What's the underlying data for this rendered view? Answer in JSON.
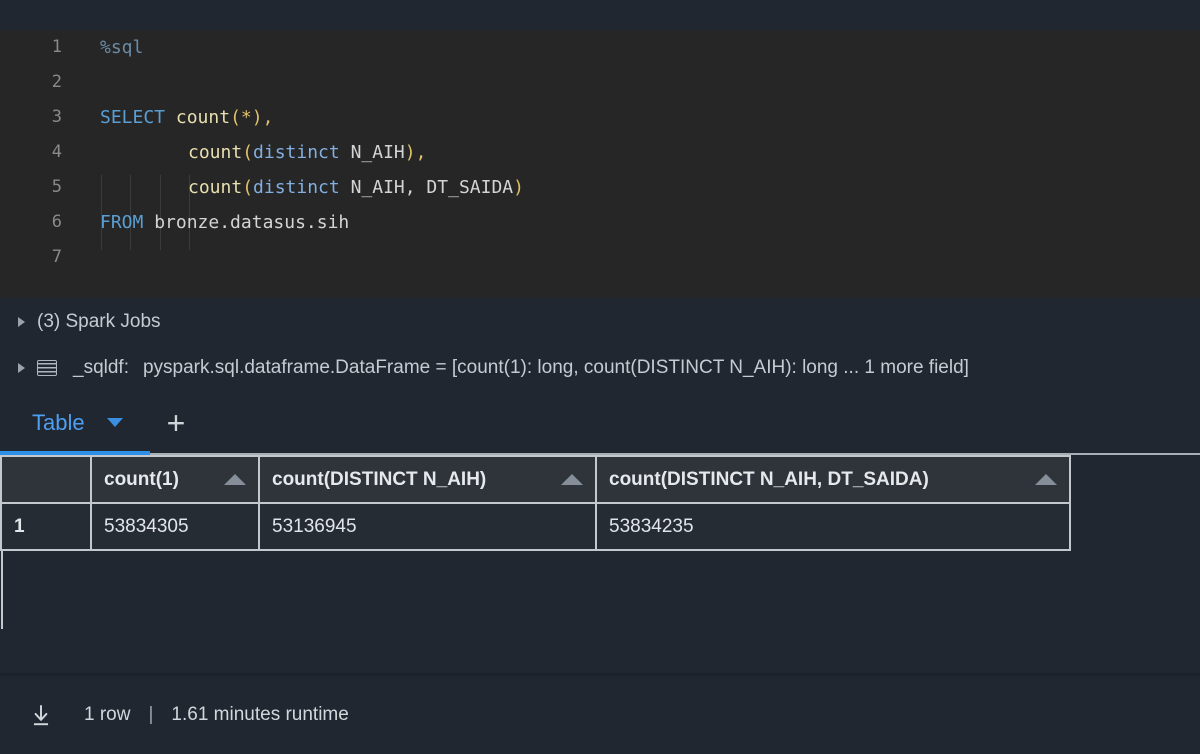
{
  "editor": {
    "language": "sql",
    "lines": [
      {
        "num": "1",
        "tokens": [
          {
            "t": "%sql",
            "c": "magic"
          }
        ]
      },
      {
        "num": "2",
        "tokens": []
      },
      {
        "num": "3",
        "tokens": [
          {
            "t": "SELECT",
            "c": "kw"
          },
          {
            "t": " ",
            "c": "plain"
          },
          {
            "t": "count",
            "c": "fn"
          },
          {
            "t": "(",
            "c": "punct"
          },
          {
            "t": "*",
            "c": "punct"
          },
          {
            "t": ")",
            "c": "punct"
          },
          {
            "t": ",",
            "c": "punct"
          }
        ]
      },
      {
        "num": "4",
        "indent": 4,
        "tokens": [
          {
            "t": "count",
            "c": "fn"
          },
          {
            "t": "(",
            "c": "punct"
          },
          {
            "t": "distinct",
            "c": "dist"
          },
          {
            "t": " N_AIH",
            "c": "plain"
          },
          {
            "t": ")",
            "c": "punct"
          },
          {
            "t": ",",
            "c": "punct"
          }
        ]
      },
      {
        "num": "5",
        "indent": 4,
        "tokens": [
          {
            "t": "count",
            "c": "fn"
          },
          {
            "t": "(",
            "c": "punct"
          },
          {
            "t": "distinct",
            "c": "dist"
          },
          {
            "t": " N_AIH, DT_SAIDA",
            "c": "plain"
          },
          {
            "t": ")",
            "c": "punct"
          }
        ]
      },
      {
        "num": "6",
        "tokens": [
          {
            "t": "FROM",
            "c": "kw"
          },
          {
            "t": " bronze.datasus.sih",
            "c": "plain"
          }
        ]
      },
      {
        "num": "7",
        "tokens": []
      }
    ]
  },
  "results": {
    "spark_jobs_label": "(3) Spark Jobs",
    "spark_jobs_expanded": false,
    "dataframe_row": {
      "expanded": false,
      "icon": "table-grid-icon",
      "variable": "_sqldf:",
      "description": "pyspark.sql.dataframe.DataFrame = [count(1): long, count(DISTINCT N_AIH): long ... 1 more field]"
    },
    "tabs": {
      "active": "Table",
      "items": [
        {
          "label": "Table",
          "active": true
        }
      ],
      "add_label": "+"
    },
    "table": {
      "index_header": "",
      "columns": [
        {
          "label": "count(1)",
          "sort": "asc"
        },
        {
          "label": "count(DISTINCT N_AIH)",
          "sort": "asc"
        },
        {
          "label": "count(DISTINCT N_AIH, DT_SAIDA)",
          "sort": "asc"
        }
      ],
      "rows": [
        {
          "index": "1",
          "cells": [
            "53834305",
            "53136945",
            "53834235"
          ]
        }
      ]
    },
    "footer": {
      "download_icon": "download-icon",
      "row_count": "1 row",
      "separator": "|",
      "runtime": "1.61 minutes runtime"
    }
  },
  "colors": {
    "accent_blue": "#2d8fe8",
    "tab_text": "#4d9ff0",
    "editor_bg": "#262626",
    "panel_bg": "#212730",
    "table_header_bg": "#2f343b",
    "table_cell_bg": "#262c34",
    "table_border": "#c3c8cd"
  }
}
